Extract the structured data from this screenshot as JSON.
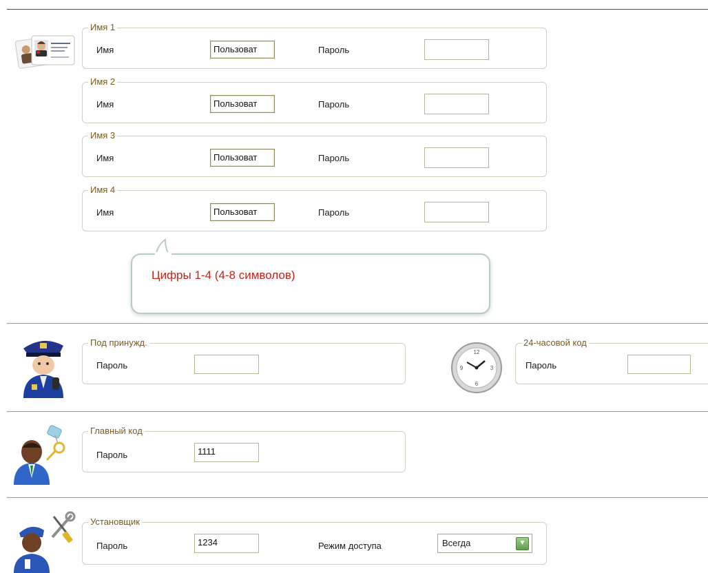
{
  "users": [
    {
      "legend": "Имя 1",
      "name_label": "Имя",
      "name_value": "Пользоват",
      "pass_label": "Пароль",
      "pass_value": ""
    },
    {
      "legend": "Имя 2",
      "name_label": "Имя",
      "name_value": "Пользоват",
      "pass_label": "Пароль",
      "pass_value": ""
    },
    {
      "legend": "Имя 3",
      "name_label": "Имя",
      "name_value": "Пользоват",
      "pass_label": "Пароль",
      "pass_value": ""
    },
    {
      "legend": "Имя 4",
      "name_label": "Имя",
      "name_value": "Пользоват",
      "pass_label": "Пароль",
      "pass_value": ""
    }
  ],
  "hint": {
    "text": "Цифры 1-4  (4-8 символов)"
  },
  "duress": {
    "legend": "Под принужд.",
    "pass_label": "Пароль",
    "pass_value": ""
  },
  "code24": {
    "legend": "24-часовой код",
    "pass_label": "Пароль",
    "pass_value": ""
  },
  "master": {
    "legend": "Главный код",
    "pass_label": "Пароль",
    "pass_value": "1111"
  },
  "installer": {
    "legend": "Установщик",
    "pass_label": "Пароль",
    "pass_value": "1234",
    "mode_label": "Режим доступа",
    "mode_value": "Всегда"
  },
  "icons": {
    "users": "id-cards-icon",
    "duress": "police-officer-icon",
    "code24": "wall-clock-icon",
    "master": "user-key-icon",
    "installer": "installer-tools-icon"
  },
  "colors": {
    "legend": "#7a5a18",
    "hint_text": "#c0241c",
    "field_border": "#b8b496"
  }
}
